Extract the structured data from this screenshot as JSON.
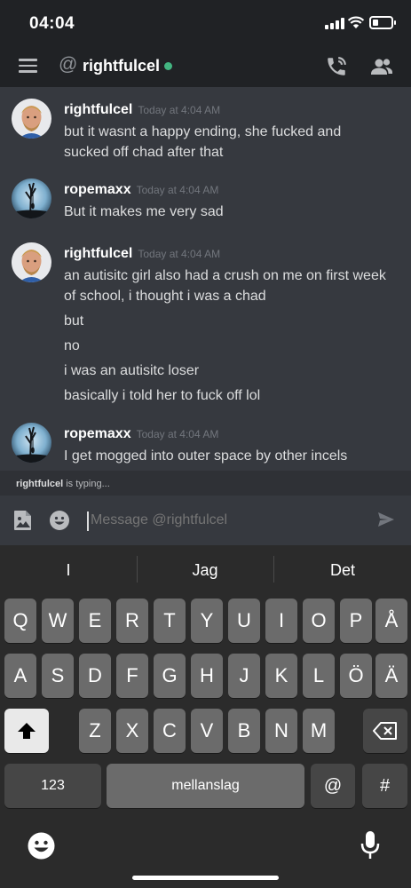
{
  "status": {
    "time": "04:04"
  },
  "header": {
    "at": "@",
    "channel": "rightfulcel"
  },
  "messages": [
    {
      "author": "rightfulcel",
      "time": "Today at 4:04 AM",
      "lines": [
        "but it wasnt a happy ending, she fucked and",
        "sucked off chad after that"
      ]
    },
    {
      "author": "ropemaxx",
      "time": "Today at 4:04 AM",
      "lines": [
        "But it makes me very sad"
      ]
    },
    {
      "author": "rightfulcel",
      "time": "Today at 4:04 AM",
      "lines": [
        "an autisitc girl also had a crush on me on first week",
        "of school, i thought i was a chad",
        "but",
        "no",
        "i was an autisitc loser",
        "basically i told her to fuck off lol"
      ]
    },
    {
      "author": "ropemaxx",
      "time": "Today at 4:04 AM",
      "lines": [
        "I get mogged into outer space by other incels"
      ]
    }
  ],
  "typing": {
    "user": "rightfulcel",
    "text": "is typing..."
  },
  "composer": {
    "placeholder": "Message @rightfulcel"
  },
  "keyboard": {
    "suggestions": [
      "I",
      "Jag",
      "Det"
    ],
    "row1": [
      "Q",
      "W",
      "E",
      "R",
      "T",
      "Y",
      "U",
      "I",
      "O",
      "P",
      "Å"
    ],
    "row2": [
      "A",
      "S",
      "D",
      "F",
      "G",
      "H",
      "J",
      "K",
      "L",
      "Ö",
      "Ä"
    ],
    "row3": [
      "Z",
      "X",
      "C",
      "V",
      "B",
      "N",
      "M"
    ],
    "numbers_key": "123",
    "space_key": "mellanslag",
    "at_key": "@",
    "hash_key": "#"
  },
  "colors": {
    "online": "#43b581",
    "background": "#36393f",
    "header": "#202225"
  },
  "icons": [
    "hamburger-menu-icon",
    "call-icon",
    "members-icon",
    "image-upload-icon",
    "emoji-icon",
    "send-icon",
    "shift-icon",
    "backspace-icon",
    "microphone-icon"
  ]
}
